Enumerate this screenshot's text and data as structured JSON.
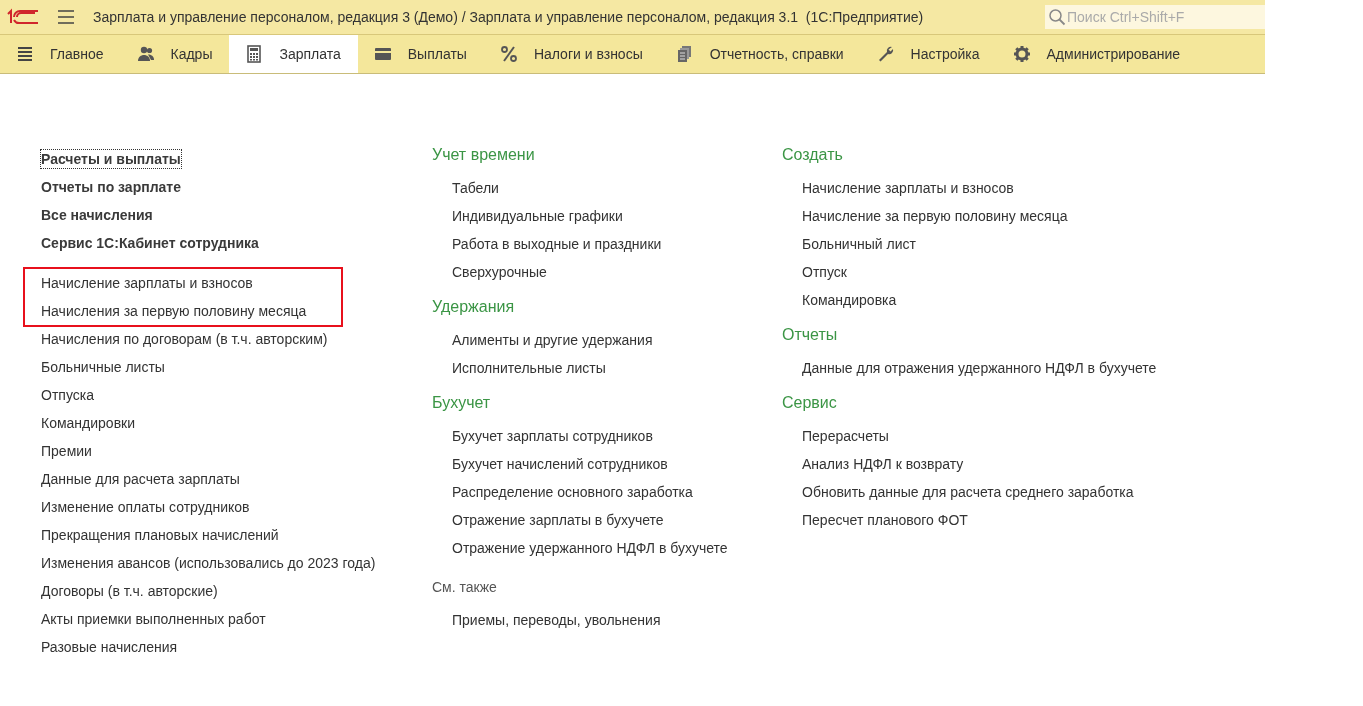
{
  "window": {
    "title": "Зарплата и управление персоналом, редакция 3 (Демо) / Зарплата и управление персоналом, редакция 3.1  (1С:Предприятие)",
    "search": {
      "placeholder": "Поиск Ctrl+Shift+F"
    }
  },
  "sections": [
    {
      "label": "Главное",
      "selected": false
    },
    {
      "label": "Кадры",
      "selected": false
    },
    {
      "label": "Зарплата",
      "selected": true
    },
    {
      "label": "Выплаты",
      "selected": false
    },
    {
      "label": "Налоги и взносы",
      "selected": false
    },
    {
      "label": "Отчетность, справки",
      "selected": false
    },
    {
      "label": "Настройка",
      "selected": false
    },
    {
      "label": "Администрирование",
      "selected": false
    }
  ],
  "left_column": [
    {
      "kind": "bold",
      "items": [
        "Расчеты и выплаты",
        "Отчеты по зарплате",
        "Все начисления",
        "Сервис 1С:Кабинет сотрудника"
      ]
    },
    {
      "kind": "highlighted",
      "items": [
        "Начисление зарплаты и взносов",
        "Начисления за первую половину месяца"
      ]
    },
    {
      "kind": "plain",
      "items": [
        "Начисления по договорам (в т.ч. авторским)",
        "Больничные листы",
        "Отпуска",
        "Командировки",
        "Премии",
        "Данные для расчета зарплаты",
        "Изменение оплаты сотрудников",
        "Прекращения плановых начислений",
        "Изменения авансов (использовались до 2023 года)",
        "Договоры (в т.ч. авторские)",
        "Акты приемки выполненных работ",
        "Разовые начисления"
      ]
    }
  ],
  "middle_column": [
    {
      "kind": "group",
      "title": "Учет времени",
      "items": [
        "Табели",
        "Индивидуальные графики",
        "Работа в выходные и праздники",
        "Сверхурочные"
      ]
    },
    {
      "kind": "group",
      "title": "Удержания",
      "items": [
        "Алименты и другие удержания",
        "Исполнительные листы"
      ]
    },
    {
      "kind": "group",
      "title": "Бухучет",
      "items": [
        "Бухучет зарплаты сотрудников",
        "Бухучет начислений сотрудников",
        "Распределение основного заработка",
        "Отражение зарплаты в бухучете",
        "Отражение удержанного НДФЛ в бухучете"
      ]
    },
    {
      "kind": "see_also",
      "title": "См. также",
      "items": [
        "Приемы, переводы, увольнения"
      ]
    }
  ],
  "right_column": [
    {
      "kind": "group",
      "title": "Создать",
      "items": [
        "Начисление зарплаты и взносов",
        "Начисление за первую половину месяца",
        "Больничный лист",
        "Отпуск",
        "Командировка"
      ]
    },
    {
      "kind": "group",
      "title": "Отчеты",
      "items": [
        "Данные для отражения удержанного НДФЛ в бухучете"
      ]
    },
    {
      "kind": "group",
      "title": "Сервис",
      "items": [
        "Перерасчеты",
        "Анализ НДФЛ к возврату",
        "Обновить данные для расчета среднего заработка",
        "Пересчет планового ФОТ"
      ]
    }
  ]
}
